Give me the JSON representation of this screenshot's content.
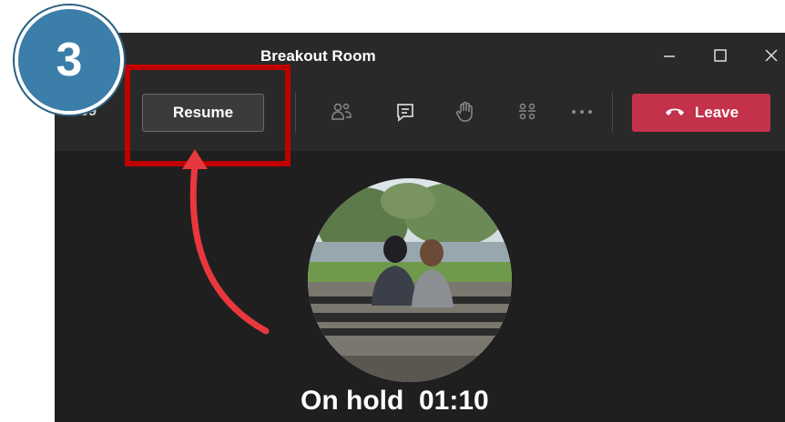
{
  "window": {
    "title": "Breakout Room",
    "controls": [
      "minimize-icon",
      "maximize-icon",
      "close-icon"
    ]
  },
  "toolbar": {
    "timer": "1:09",
    "resume_label": "Resume",
    "icons": [
      "participants-icon",
      "chat-icon",
      "raise-hand-icon",
      "breakout-rooms-icon",
      "more-options-icon"
    ],
    "leave_label": "Leave"
  },
  "call": {
    "status": "On hold",
    "duration": "01:10"
  },
  "annotation": {
    "step_number": "3"
  },
  "colors": {
    "leave": "#c4314b",
    "highlight": "#c00000",
    "arrow": "#e8383d",
    "badge": "#3a7ea9"
  }
}
